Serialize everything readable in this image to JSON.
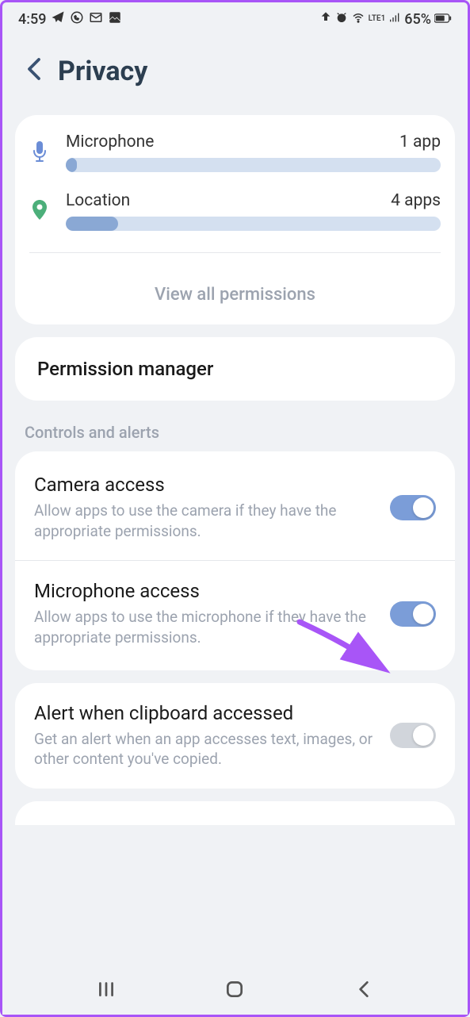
{
  "status_bar": {
    "time": "4:59",
    "battery": "65%",
    "network": "LTE1"
  },
  "header": {
    "title": "Privacy"
  },
  "permissions": {
    "microphone": {
      "label": "Microphone",
      "count": "1 app",
      "fill_pct": 3
    },
    "location": {
      "label": "Location",
      "count": "4 apps",
      "fill_pct": 14
    },
    "view_all": "View all permissions"
  },
  "permission_manager": {
    "label": "Permission manager"
  },
  "section_controls": "Controls and alerts",
  "camera_access": {
    "title": "Camera access",
    "desc": "Allow apps to use the camera if they have the appropriate permissions.",
    "on": true
  },
  "microphone_access": {
    "title": "Microphone access",
    "desc": "Allow apps to use the microphone if they have the appropriate permissions.",
    "on": true
  },
  "clipboard_alert": {
    "title": "Alert when clipboard accessed",
    "desc": "Get an alert when an app accesses text, images, or other content you've copied.",
    "on": false
  }
}
